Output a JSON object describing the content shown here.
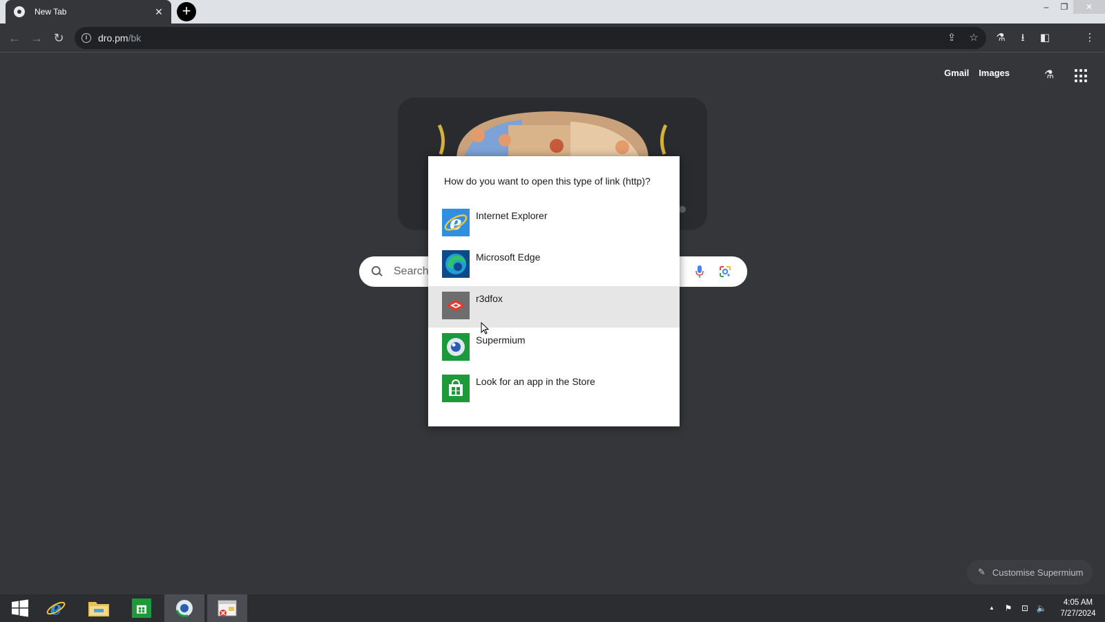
{
  "browser": {
    "tab": {
      "title": "New Tab",
      "close_glyph": "✕"
    },
    "new_tab_glyph": "+",
    "window_controls": {
      "minimize": "–",
      "restore": "❐",
      "close": "✕"
    },
    "toolbar": {
      "back": "←",
      "forward": "→",
      "reload": "↻"
    },
    "omnibox": {
      "host": "dro.pm",
      "path": "/bk",
      "info_glyph": "i"
    },
    "actions": {
      "share": "⇪",
      "bookmark": "☆",
      "labs": "⚗",
      "download": "⭳",
      "sidepanel": "◧",
      "menu": "⋮"
    }
  },
  "ntp": {
    "links": {
      "gmail": "Gmail",
      "images": "Images"
    },
    "labs_glyph": "⚗",
    "search_placeholder": "Search",
    "customise_label": "Customise Supermium",
    "pencil_glyph": "✎"
  },
  "dialog": {
    "title": "How do you want to open this type of link (http)?",
    "apps": [
      {
        "label": "Internet Explorer",
        "icon": "internet-explorer-icon"
      },
      {
        "label": "Microsoft Edge",
        "icon": "microsoft-edge-icon"
      },
      {
        "label": "r3dfox",
        "icon": "r3dfox-icon",
        "hovered": true
      },
      {
        "label": "Supermium",
        "icon": "supermium-icon"
      },
      {
        "label": "Look for an app in the Store",
        "icon": "store-icon"
      }
    ]
  },
  "taskbar": {
    "apps": [
      "start-icon",
      "internet-explorer-icon",
      "file-explorer-icon",
      "store-icon",
      "supermium-icon",
      "dialog-window-icon"
    ],
    "tray": {
      "chevron": "▲",
      "flag": "⚑",
      "network": "⊡",
      "volume": "🔈"
    },
    "clock": {
      "time": "4:05 AM",
      "date": "7/27/2024"
    }
  },
  "colors": {
    "page_bg": "#35363a",
    "tab_strip": "#dee1e6",
    "dialog_bg": "#ffffff",
    "dialog_hover": "#e6e6e6",
    "taskbar": "#2b2d31"
  }
}
